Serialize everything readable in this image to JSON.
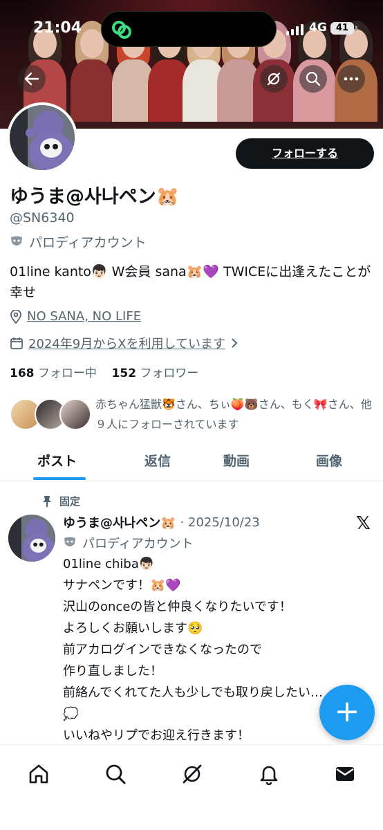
{
  "status_bar": {
    "time": "21:04",
    "network": "4G",
    "battery": "41"
  },
  "banner": {
    "back_icon": "back-arrow-icon",
    "icons": [
      "grok-icon",
      "search-icon",
      "more-icon"
    ]
  },
  "profile": {
    "follow_button": "フォローする",
    "name": "ゆうま@사나ペン🐹",
    "handle": "@SN6340",
    "parody_label": "パロディアカウント",
    "bio": "01line kanto👦🏻 W会員 sana🐹💜 TWICEに出逢えたことが幸せ",
    "location": "NO SANA, NO LIFE",
    "joined": "2024年9月からXを利用しています",
    "following_count": "168",
    "following_label": "フォロー中",
    "followers_count": "152",
    "followers_label": "フォロワー",
    "followed_by": "赤ちゃん猛獣🐯さん、ちぃ🍑🐻さん、もく🎀さん、他９人にフォローされています"
  },
  "tabs": [
    "ポスト",
    "返信",
    "動画",
    "画像"
  ],
  "pinned_post": {
    "pinned_label": "固定",
    "author": "ゆうま@사나ペン🐹",
    "date": "· 2025/10/23",
    "parody_label": "パロディアカウント",
    "lines": [
      "01line chiba👦🏻",
      "サナペンです！🐹💜",
      "沢山のonceの皆と仲良くなりたいです！",
      "よろしくお願いします🥺",
      "前アカログインできなくなったので",
      "作り直しました！",
      "前絡んでくれてた人も少しでも取り戻したい…",
      "💭",
      "いいねやリプでお迎え行きます！"
    ]
  },
  "fab_label": "+",
  "bottom_nav": [
    "home-icon",
    "search-icon",
    "grok-icon",
    "notifications-icon",
    "messages-icon"
  ],
  "colors": {
    "accent": "#1d9bf0",
    "text": "#0f1419",
    "muted": "#536471"
  }
}
